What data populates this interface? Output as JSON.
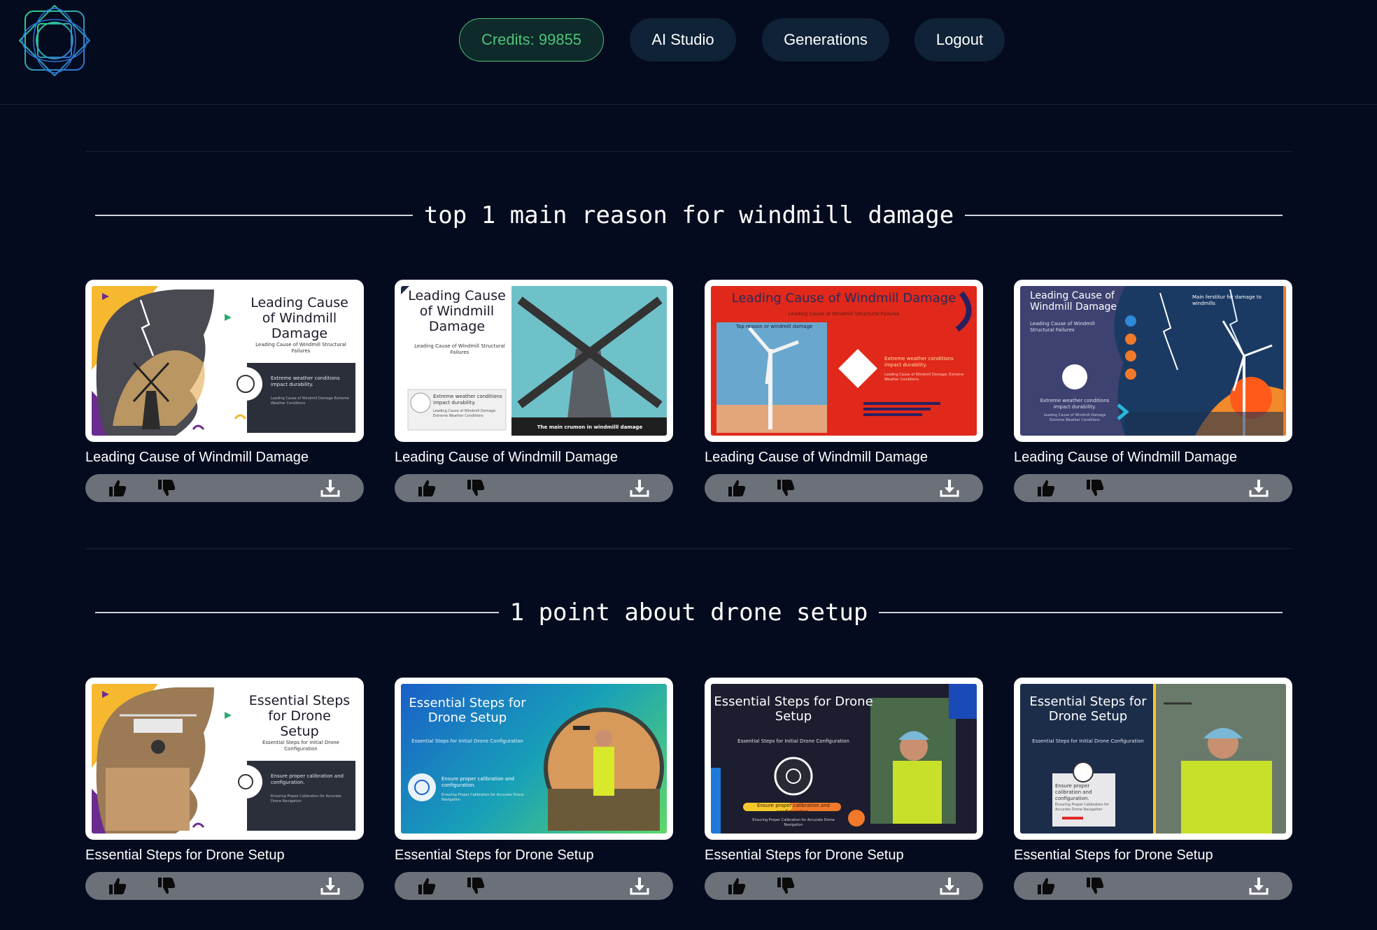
{
  "nav": {
    "credits_label": "Credits: 99855",
    "ai_studio_label": "AI Studio",
    "generations_label": "Generations",
    "logout_label": "Logout"
  },
  "colors": {
    "background": "#050b1e",
    "nav_button": "#0f2237",
    "credits_accent": "#4ec27a",
    "action_bar": "#6b7079"
  },
  "sections": [
    {
      "heading": "top 1 main reason for windmill damage",
      "cards": [
        {
          "title": "Leading Cause of Windmill Damage",
          "slide": {
            "title": "Leading Cause of Windmill Damage",
            "subtitle": "Leading Cause of Windmill Structural Failures",
            "point": "Extreme weather conditions impact durability.",
            "detail": "Leading Cause of Windmill Damage Extreme Weather Conditions"
          }
        },
        {
          "title": "Leading Cause of Windmill Damage",
          "slide": {
            "title": "Leading Cause of Windmill Damage",
            "subtitle": "Leading Cause of Windmill Structural Failures",
            "point": "Extreme weather conditions impact durability.",
            "detail": "Leading Cause of Windmill Damage Extreme Weather Conditions",
            "caption": "The main crumon in windmilll damage"
          }
        },
        {
          "title": "Leading Cause of Windmill Damage",
          "slide": {
            "title": "Leading Cause of Windmill Damage",
            "subtitle": "Leading Cause of Windmill Structural Failures",
            "image_caption": "Top reason or windmill damage",
            "point": "Extreme weather conditions impact durability.",
            "detail": "Leading Cause of Windmill Damage: Extreme Weather Conditions"
          }
        },
        {
          "title": "Leading Cause of Windmill Damage",
          "slide": {
            "title": "Leading Cause of Windmill Damage",
            "subtitle": "Leading Cause of Windmill Structural Failures",
            "point": "Extreme weather conditions impact durability.",
            "detail": "Leading Cause of Windmill Damage Extreme Weather Conditions",
            "image_caption": "Main ferstitur for damage to windmills"
          }
        }
      ]
    },
    {
      "heading": "1 point about drone setup",
      "cards": [
        {
          "title": "Essential Steps for Drone Setup",
          "slide": {
            "title": "Essential Steps for Drone Setup",
            "subtitle": "Essential Steps for Initial Drone Configuration",
            "point": "Ensure proper calibration and configuration.",
            "detail": "Ensuring Proper Calibration for Accurate Drone Navigation"
          }
        },
        {
          "title": "Essential Steps for Drone Setup",
          "slide": {
            "title": "Essential Steps for Drone Setup",
            "subtitle": "Essential Steps for Initial Drone Configuration",
            "point": "Ensure proper calibration and configuration.",
            "detail": "Ensuring Proper Calibration for Accurate Drone Navigation"
          }
        },
        {
          "title": "Essential Steps for Drone Setup",
          "slide": {
            "title": "Essential Steps for Drone Setup",
            "subtitle": "Essential Steps for Initial Drone Configuration",
            "point": "Ensure proper calibration and configuration.",
            "detail": "Ensuring Proper Calibration for Accurate Drone Navigation"
          }
        },
        {
          "title": "Essential Steps for Drone Setup",
          "slide": {
            "title": "Essential Steps for Drone Setup",
            "subtitle": "Essential Steps for Initial Drone Configuration",
            "point": "Ensure proper calibration and configuration.",
            "detail": "Ensuring Proper Calibration for Accurate Drone Navigation"
          }
        }
      ]
    }
  ]
}
